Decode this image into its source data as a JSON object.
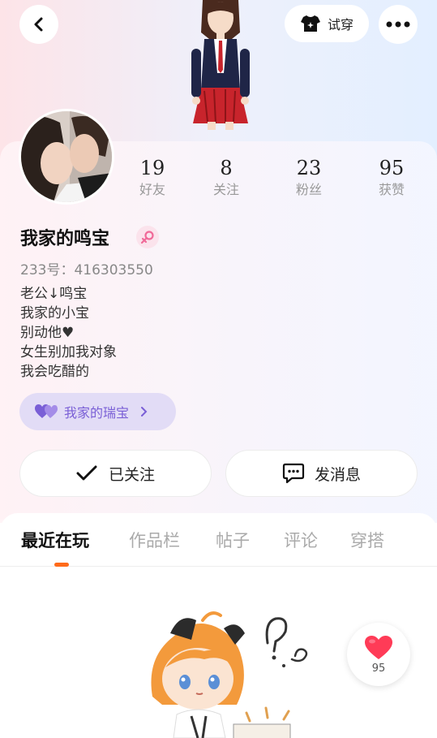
{
  "header": {
    "back_icon": "chevron-left-icon",
    "try_on_label": "试穿",
    "try_on_icon": "tshirt-icon",
    "more_icon": "more-dots-icon"
  },
  "profile": {
    "name": "我家的鸣宝",
    "gender_icon": "female-symbol-icon",
    "uid_label": "233号：",
    "uid_value": "416303550",
    "bio": [
      "老公↓鸣宝",
      "我家的小宝",
      "别动他♥",
      "女生别加我对象",
      "我会吃醋的"
    ],
    "tag": {
      "label": "我家的瑞宝",
      "icon": "double-heart-icon"
    }
  },
  "stats": [
    {
      "value": "19",
      "label": "好友"
    },
    {
      "value": "8",
      "label": "关注"
    },
    {
      "value": "23",
      "label": "粉丝"
    },
    {
      "value": "95",
      "label": "获赞"
    }
  ],
  "actions": {
    "follow_label": "已关注",
    "follow_icon": "check-icon",
    "message_label": "发消息",
    "message_icon": "chat-bubble-icon"
  },
  "tabs": [
    "最近在玩",
    "作品栏",
    "帖子",
    "评论",
    "穿搭"
  ],
  "active_tab": "最近在玩",
  "like": {
    "count": "95",
    "icon": "heart-icon"
  },
  "colors": {
    "accent": "#ff6a1a",
    "heart": "#ff3b57",
    "tag_text": "#7a5fd6"
  }
}
